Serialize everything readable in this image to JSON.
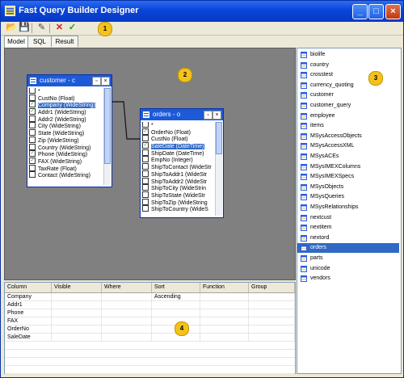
{
  "window": {
    "title": "Fast Query Builder Designer",
    "minimize": "_",
    "maximize": "□",
    "close": "×"
  },
  "toolbar": {
    "open": "📂",
    "save": "💾",
    "edit": "✎",
    "cancel": "✕",
    "ok": "✓"
  },
  "tabs": [
    {
      "label": "Model"
    },
    {
      "label": "SQL"
    },
    {
      "label": "Result"
    }
  ],
  "badges": {
    "one": "1",
    "two": "2",
    "three": "3",
    "four": "4"
  },
  "colors": {
    "accent": "#f3c31c",
    "title": "#0a44d8",
    "canvas": "#808080",
    "selection": "#316ac5"
  },
  "customer_table": {
    "title": "customer - c",
    "fields": [
      {
        "label": "*",
        "checked": false,
        "sel": false
      },
      {
        "label": "CustNo (Float)",
        "checked": false,
        "sel": false
      },
      {
        "label": "Company (WideString)",
        "checked": true,
        "sel": true
      },
      {
        "label": "Addr1 (WideString)",
        "checked": true,
        "sel": false
      },
      {
        "label": "Addr2 (WideString)",
        "checked": false,
        "sel": false
      },
      {
        "label": "City (WideString)",
        "checked": false,
        "sel": false
      },
      {
        "label": "State (WideString)",
        "checked": false,
        "sel": false
      },
      {
        "label": "Zip (WideString)",
        "checked": false,
        "sel": false
      },
      {
        "label": "Country (WideString)",
        "checked": false,
        "sel": false
      },
      {
        "label": "Phone (WideString)",
        "checked": true,
        "sel": false
      },
      {
        "label": "FAX (WideString)",
        "checked": true,
        "sel": false
      },
      {
        "label": "TaxRate (Float)",
        "checked": false,
        "sel": false
      },
      {
        "label": "Contact (WideString)",
        "checked": false,
        "sel": false
      }
    ]
  },
  "orders_table": {
    "title": "orders - o",
    "fields": [
      {
        "label": "*",
        "checked": false,
        "sel": false
      },
      {
        "label": "OrderNo (Float)",
        "checked": true,
        "sel": false
      },
      {
        "label": "CustNo (Float)",
        "checked": false,
        "sel": false
      },
      {
        "label": "SaleDate (DateTime)",
        "checked": true,
        "sel": true
      },
      {
        "label": "ShipDate (DateTime)",
        "checked": false,
        "sel": false
      },
      {
        "label": "EmpNo (Integer)",
        "checked": false,
        "sel": false
      },
      {
        "label": "ShipToContact (WideStr",
        "checked": false,
        "sel": false
      },
      {
        "label": "ShipToAddr1 (WideStr",
        "checked": false,
        "sel": false
      },
      {
        "label": "ShipToAddr2 (WideStr",
        "checked": false,
        "sel": false
      },
      {
        "label": "ShipToCity (WideStrin",
        "checked": false,
        "sel": false
      },
      {
        "label": "ShipToState (WideStr",
        "checked": false,
        "sel": false
      },
      {
        "label": "ShipToZip (WideString",
        "checked": false,
        "sel": false
      },
      {
        "label": "ShipToCountry (WideS",
        "checked": false,
        "sel": false
      }
    ]
  },
  "grid": {
    "columns": [
      "Column",
      "Visible",
      "Where",
      "Sort",
      "Function",
      "Group"
    ],
    "rows": [
      {
        "column": "Company",
        "visible": "",
        "where": "",
        "sort": "Ascending",
        "function": "",
        "group": ""
      },
      {
        "column": "Addr1",
        "visible": "",
        "where": "",
        "sort": "",
        "function": "",
        "group": ""
      },
      {
        "column": "Phone",
        "visible": "",
        "where": "",
        "sort": "",
        "function": "",
        "group": ""
      },
      {
        "column": "FAX",
        "visible": "",
        "where": "",
        "sort": "",
        "function": "",
        "group": ""
      },
      {
        "column": "OrderNo",
        "visible": "",
        "where": "",
        "sort": "",
        "function": "",
        "group": ""
      },
      {
        "column": "SaleDate",
        "visible": "",
        "where": "",
        "sort": "",
        "function": "",
        "group": ""
      }
    ]
  },
  "table_list": {
    "items": [
      "biolife",
      "country",
      "crosstest",
      "currency_quoting",
      "customer",
      "customer_query",
      "employee",
      "items",
      "MSysAccessObjects",
      "MSysAccessXML",
      "MSysACEs",
      "MSysIMEXColumns",
      "MSysIMEXSpecs",
      "MSysObjects",
      "MSysQueries",
      "MSysRelationships",
      "nextcust",
      "nextitem",
      "nextord",
      "orders",
      "parts",
      "unicode",
      "vendors"
    ],
    "selected": "orders"
  }
}
